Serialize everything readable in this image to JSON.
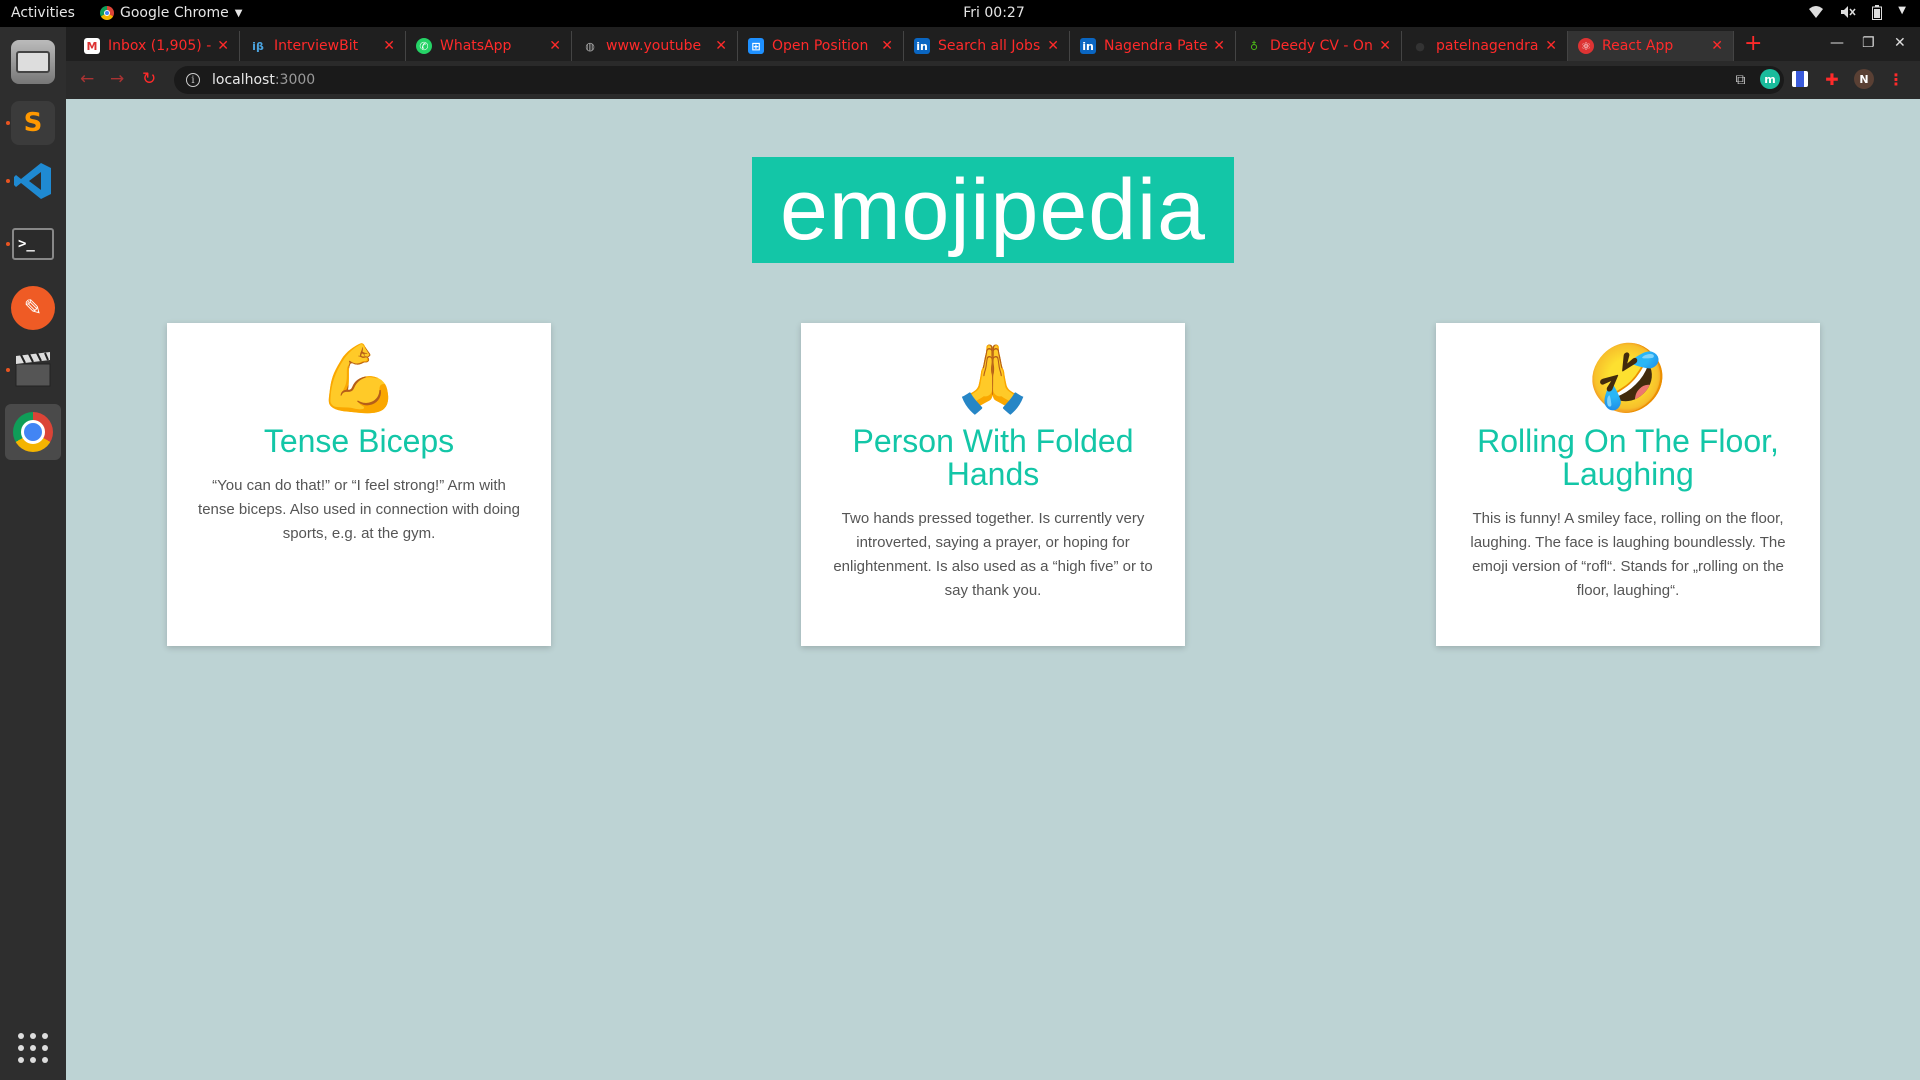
{
  "topbar": {
    "activities": "Activities",
    "app_name": "Google Chrome",
    "clock": "Fri 00:27"
  },
  "dock": {
    "items": [
      {
        "name": "files",
        "icon": "file-cabinet-icon"
      },
      {
        "name": "sublime-text",
        "icon": "sublime-text-icon"
      },
      {
        "name": "vscode",
        "icon": "vscode-icon"
      },
      {
        "name": "terminal",
        "icon": "terminal-icon"
      },
      {
        "name": "postman",
        "icon": "postman-icon"
      },
      {
        "name": "video-editor",
        "icon": "clapperboard-icon"
      },
      {
        "name": "chrome",
        "icon": "chrome-icon"
      }
    ]
  },
  "browser": {
    "tabs": [
      {
        "title": "Inbox (1,905) - ",
        "favicon": "gmail-icon"
      },
      {
        "title": "InterviewBit",
        "favicon": "interviewbit-icon"
      },
      {
        "title": "WhatsApp",
        "favicon": "whatsapp-icon"
      },
      {
        "title": "www.youtube",
        "favicon": "globe-icon"
      },
      {
        "title": "Open Position",
        "favicon": "windows-icon"
      },
      {
        "title": "Search all Jobs",
        "favicon": "linkedin-icon"
      },
      {
        "title": "Nagendra Pate",
        "favicon": "linkedin-icon"
      },
      {
        "title": "Deedy CV - Onl",
        "favicon": "overleaf-icon"
      },
      {
        "title": "patelnagendra",
        "favicon": "github-icon"
      },
      {
        "title": "React App",
        "favicon": "react-icon"
      }
    ],
    "url_host": "localhost",
    "url_port": ":3000",
    "profile_initial": "N"
  },
  "page": {
    "title": "emojipedia",
    "cards": [
      {
        "emoji": "💪",
        "name": "Tense Biceps",
        "description": "“You can do that!” or “I feel strong!” Arm with tense biceps. Also used in connection with doing sports, e.g. at the gym."
      },
      {
        "emoji": "🙏",
        "name": "Person With Folded Hands",
        "description": "Two hands pressed together. Is currently very introverted, saying a prayer, or hoping for enlightenment. Is also used as a “high five” or to say thank you."
      },
      {
        "emoji": "🤣",
        "name": "Rolling On The Floor, Laughing",
        "description": "This is funny! A smiley face, rolling on the floor, laughing. The face is laughing boundlessly. The emoji version of “rofl“. Stands for „rolling on the floor, laughing“."
      }
    ]
  },
  "colors": {
    "accent": "#13c6a7",
    "page_bg": "#bdd3d4",
    "tab_text": "#ff2a2a"
  }
}
